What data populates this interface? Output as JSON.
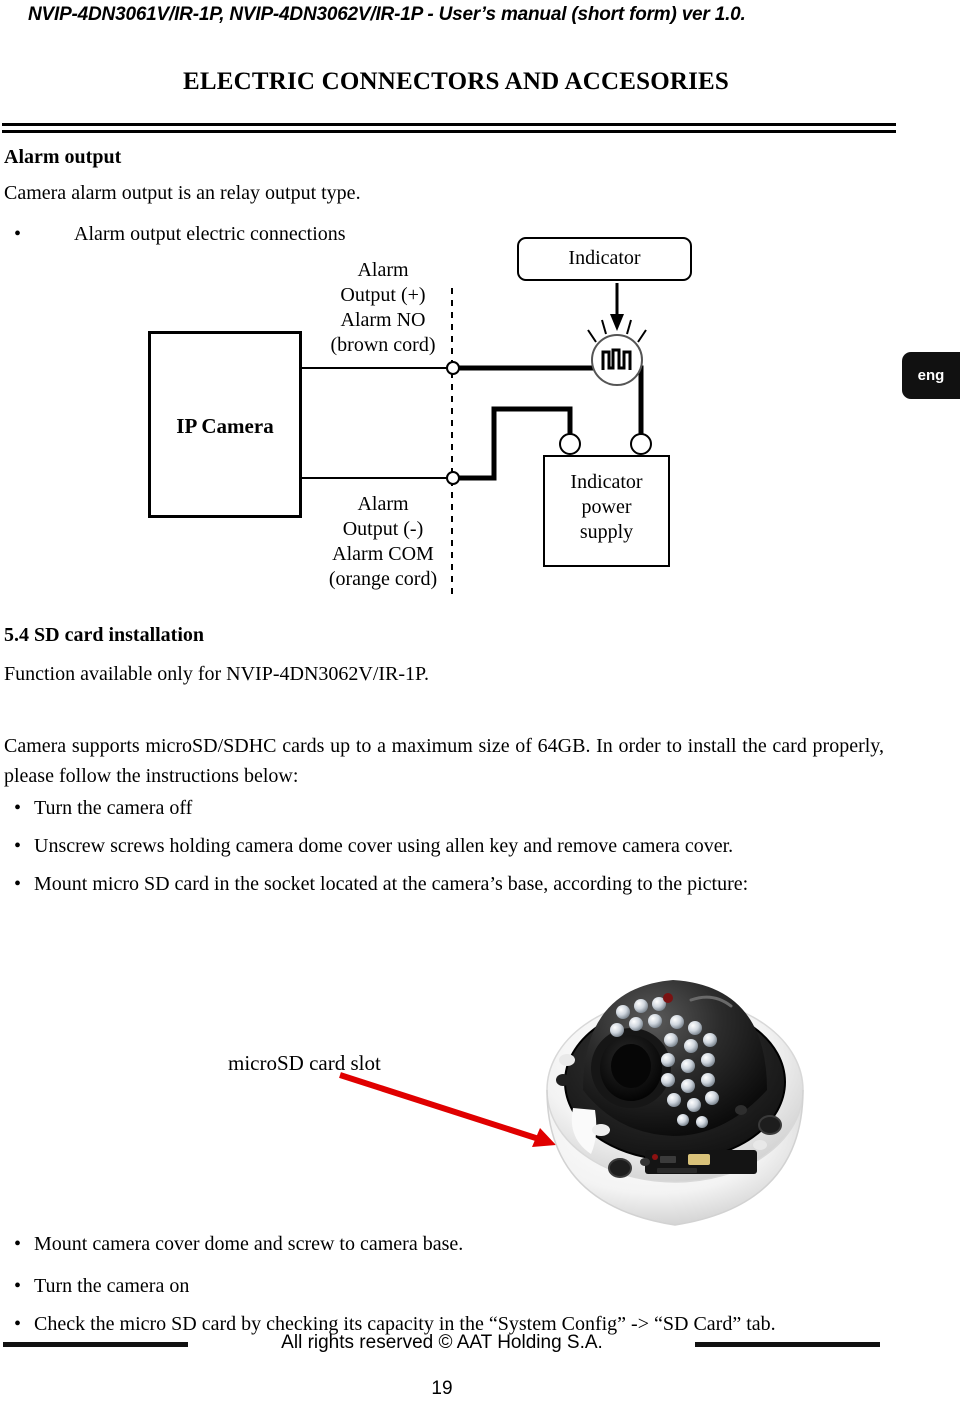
{
  "header": {
    "running_head": "NVIP-4DN3061V/IR-1P, NVIP-4DN3062V/IR-1P - User’s manual (short form) ver 1.0.",
    "section_title": "ELECTRIC CONNECTORS AND ACCESORIES"
  },
  "language_tab": {
    "label": "eng"
  },
  "alarm_section": {
    "heading": "Alarm output",
    "intro": "Camera alarm output is an relay output type.",
    "bullet": {
      "marker": "•",
      "text": "Alarm output electric connections"
    }
  },
  "diagram": {
    "camera_block": "IP Camera",
    "indicator_block": "Indicator",
    "power_supply_block": "Indicator\npower\nsupply",
    "power_supply_lines": [
      "Indicator",
      "power",
      "supply"
    ],
    "output_plus_lines": [
      "Alarm",
      "Output (+)",
      "Alarm NO",
      "(brown cord)"
    ],
    "output_minus_lines": [
      "Alarm",
      "Output (-)",
      "Alarm COM",
      "(orange cord)"
    ]
  },
  "sd_section": {
    "heading": "5.4 SD card installation",
    "availability": "Function available only for NVIP-4DN3062V/IR-1P.",
    "paragraph": "Camera supports microSD/SDHC cards up to a maximum size of 64GB. In order to install the card properly, please follow the instructions below:",
    "bullets_before_photo": [
      "Turn the camera off",
      "Unscrew screws holding camera dome cover using allen key and remove camera cover.",
      "Mount micro SD card in the socket located at the camera’s base, according to the picture:"
    ],
    "photo_callout": "microSD card slot",
    "bullets_after_photo": [
      "Mount camera cover dome and screw to camera base.",
      "Turn the camera on",
      "Check the micro SD card by checking its capacity in the “System Config” -> “SD Card” tab."
    ],
    "bullet_marker": "•"
  },
  "footer": {
    "copyright": "All rights reserved © AAT Holding S.A.",
    "page_number": "19"
  },
  "colors": {
    "ink": "#000000",
    "callout_arrow": "#e00000",
    "tab_background": "#111111",
    "tab_text": "#ffffff"
  }
}
